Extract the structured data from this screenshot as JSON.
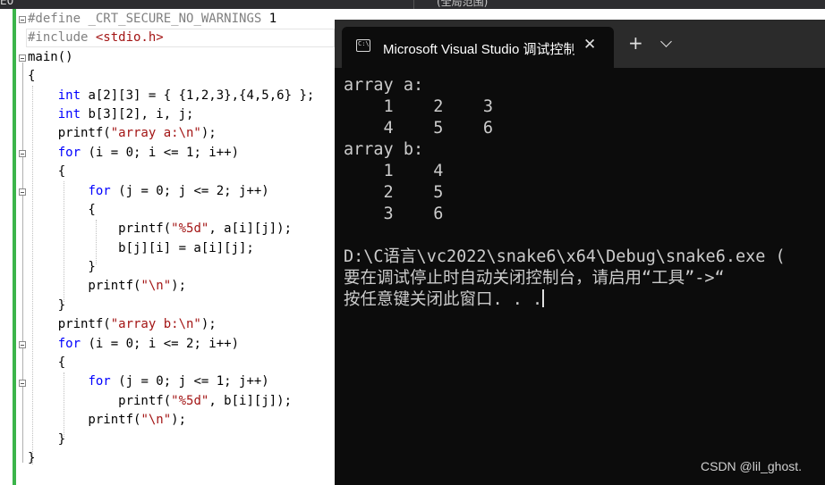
{
  "top_strip": {
    "left_fragment": "E0",
    "right_fragment": "(全局范围)"
  },
  "editor": {
    "lines": [
      [
        {
          "t": "#define ",
          "c": "pp"
        },
        {
          "t": "_CRT_SECURE_NO_WARNINGS",
          "c": "pp"
        },
        {
          "t": " 1",
          "c": "num"
        }
      ],
      [
        {
          "t": "#include ",
          "c": "pp"
        },
        {
          "t": "<stdio.h>",
          "c": "str"
        }
      ],
      [
        {
          "t": "main()",
          "c": ""
        }
      ],
      [
        {
          "t": "{",
          "c": ""
        }
      ],
      [
        {
          "t": "    ",
          "c": ""
        },
        {
          "t": "int",
          "c": "kw"
        },
        {
          "t": " a[2][3] = { {1,2,3},{4,5,6} };",
          "c": ""
        }
      ],
      [
        {
          "t": "    ",
          "c": ""
        },
        {
          "t": "int",
          "c": "kw"
        },
        {
          "t": " b[3][2], i, j;",
          "c": ""
        }
      ],
      [
        {
          "t": "    printf(",
          "c": ""
        },
        {
          "t": "\"array a:\\n\"",
          "c": "str"
        },
        {
          "t": ");",
          "c": ""
        }
      ],
      [
        {
          "t": "    ",
          "c": ""
        },
        {
          "t": "for",
          "c": "kw"
        },
        {
          "t": " (i = 0; i <= 1; i++)",
          "c": ""
        }
      ],
      [
        {
          "t": "    {",
          "c": ""
        }
      ],
      [
        {
          "t": "        ",
          "c": ""
        },
        {
          "t": "for",
          "c": "kw"
        },
        {
          "t": " (j = 0; j <= 2; j++)",
          "c": ""
        }
      ],
      [
        {
          "t": "        {",
          "c": ""
        }
      ],
      [
        {
          "t": "            printf(",
          "c": ""
        },
        {
          "t": "\"%5d\"",
          "c": "str"
        },
        {
          "t": ", a[i][j]);",
          "c": ""
        }
      ],
      [
        {
          "t": "            b[j][i] = a[i][j];",
          "c": ""
        }
      ],
      [
        {
          "t": "        }",
          "c": ""
        }
      ],
      [
        {
          "t": "        printf(",
          "c": ""
        },
        {
          "t": "\"\\n\"",
          "c": "str"
        },
        {
          "t": ");",
          "c": ""
        }
      ],
      [
        {
          "t": "    }",
          "c": ""
        }
      ],
      [
        {
          "t": "    printf(",
          "c": ""
        },
        {
          "t": "\"array b:\\n\"",
          "c": "str"
        },
        {
          "t": ");",
          "c": ""
        }
      ],
      [
        {
          "t": "    ",
          "c": ""
        },
        {
          "t": "for",
          "c": "kw"
        },
        {
          "t": " (i = 0; i <= 2; i++)",
          "c": ""
        }
      ],
      [
        {
          "t": "    {",
          "c": ""
        }
      ],
      [
        {
          "t": "        ",
          "c": ""
        },
        {
          "t": "for",
          "c": "kw"
        },
        {
          "t": " (j = 0; j <= 1; j++)",
          "c": ""
        }
      ],
      [
        {
          "t": "            printf(",
          "c": ""
        },
        {
          "t": "\"%5d\"",
          "c": "str"
        },
        {
          "t": ", b[i][j]);",
          "c": ""
        }
      ],
      [
        {
          "t": "        printf(",
          "c": ""
        },
        {
          "t": "\"\\n\"",
          "c": "str"
        },
        {
          "t": ");",
          "c": ""
        }
      ],
      [
        {
          "t": "    }",
          "c": ""
        }
      ],
      [
        {
          "t": "}",
          "c": ""
        }
      ]
    ],
    "colors": {
      "keyword": "#0000ff",
      "preprocessor": "#808080",
      "string": "#a31515",
      "change_bar": "#3bb54a"
    }
  },
  "console": {
    "tab_title": "Microsoft Visual Studio 调试控制台",
    "tab_close_icon": "close-icon",
    "new_tab_icon": "plus-icon",
    "dropdown_icon": "chevron-down-icon",
    "output_lines": [
      "array a:",
      "    1    2    3",
      "    4    5    6",
      "array b:",
      "    1    4",
      "    2    5",
      "    3    6",
      "",
      "D:\\C语言\\vc2022\\snake6\\x64\\Debug\\snake6.exe (",
      "要在调试停止时自动关闭控制台，请启用“工具”->“",
      "按任意键关闭此窗口. . ."
    ]
  },
  "watermark": "CSDN @lil_ghost."
}
